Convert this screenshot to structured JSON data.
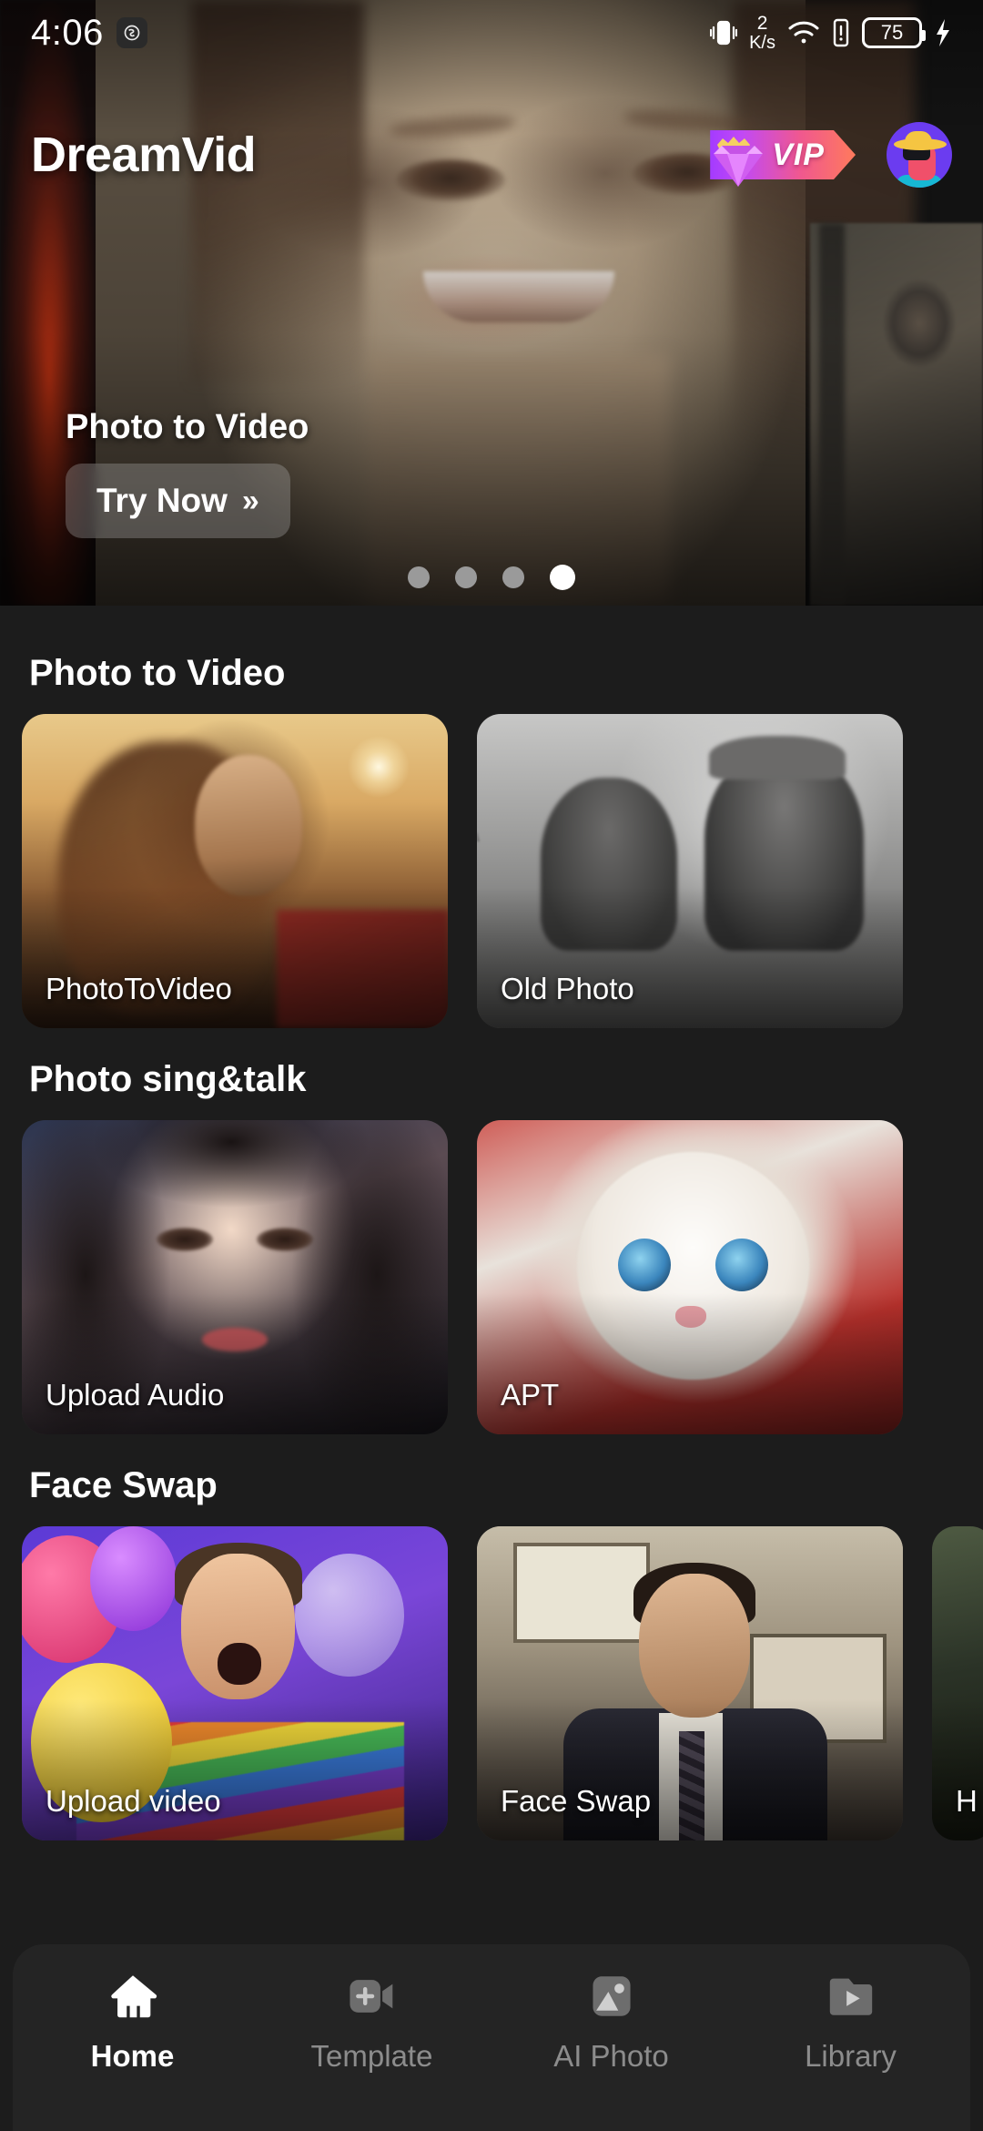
{
  "status_bar": {
    "time": "4:06",
    "dnd_icon": "do-not-disturb-icon",
    "vibrate_icon": "vibrate-icon",
    "network_speed_value": "2",
    "network_speed_unit": "K/s",
    "wifi_icon": "wifi-icon",
    "alert_icon": "alert-icon",
    "battery_level": "75",
    "charging_icon": "charging-bolt-icon"
  },
  "header": {
    "brand": "DreamVid",
    "vip_label": "VIP",
    "vip_gem_icon": "diamond-crown-icon",
    "avatar_alt": "user-avatar"
  },
  "hero": {
    "title": "Photo to Video",
    "cta_label": "Try Now",
    "cta_chevron": "»",
    "dots_total": 4,
    "active_dot": 4
  },
  "sections": [
    {
      "title": "Photo to Video",
      "cards": [
        {
          "label": "PhotoToVideo",
          "art": "art-p2v"
        },
        {
          "label": "Old Photo",
          "art": "art-old"
        }
      ]
    },
    {
      "title": "Photo sing&talk",
      "cards": [
        {
          "label": "Upload Audio",
          "art": "art-sing"
        },
        {
          "label": "APT",
          "art": "art-cat"
        }
      ]
    },
    {
      "title": "Face Swap",
      "cards": [
        {
          "label": "Upload video",
          "art": "art-swap1"
        },
        {
          "label": "Face Swap",
          "art": "art-swap2"
        },
        {
          "label": "H",
          "art": "art-partial",
          "partial": true
        }
      ]
    }
  ],
  "bottom_nav": {
    "items": [
      {
        "label": "Home",
        "icon": "home-icon",
        "active": true
      },
      {
        "label": "Template",
        "icon": "video-plus-icon",
        "active": false
      },
      {
        "label": "AI Photo",
        "icon": "image-icon",
        "active": false
      },
      {
        "label": "Library",
        "icon": "folder-play-icon",
        "active": false
      }
    ]
  },
  "colors": {
    "background": "#1c1c1c",
    "nav_background": "#242424",
    "accent_vip_start": "#a43bff",
    "accent_vip_end": "#ff7a5c",
    "active_text": "#ffffff",
    "inactive_text": "#8c8c8c"
  }
}
